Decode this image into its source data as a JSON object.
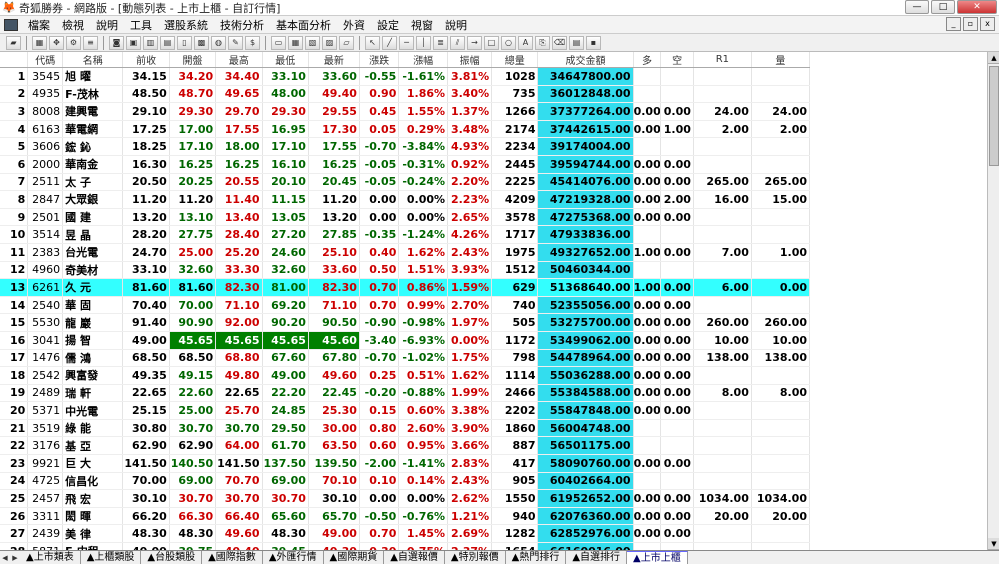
{
  "window": {
    "title": "奇狐勝券 - 網路版 - [動態列表 - 上市上櫃 - 自訂行情]",
    "app_icon": "fox-icon"
  },
  "menu": [
    "檔案",
    "檢視",
    "說明",
    "工具",
    "選股系統",
    "技術分析",
    "基本面分析",
    "外資",
    "設定",
    "視窗",
    "說明"
  ],
  "columns": [
    "代碼",
    "名稱",
    "前收",
    "開盤",
    "最高",
    "最低",
    "最新",
    "漲跌",
    "漲幅",
    "振幅",
    "總量",
    "成交金額",
    "多",
    "空",
    "R1",
    "量"
  ],
  "rows": [
    {
      "idx": "1",
      "code": "3545",
      "name": "旭 曜",
      "prev": "34.15",
      "open": "34.20",
      "high": "34.40",
      "low": "33.10",
      "last": "33.60",
      "chg": "-0.55",
      "pct": "-1.61%",
      "amp": "3.81%",
      "vol": "1028",
      "tv": "34647800.00",
      "long": "",
      "short": "",
      "r1": "",
      "q": "",
      "oc": "up",
      "hc": "up",
      "lc": "dn",
      "lac": "dn"
    },
    {
      "idx": "2",
      "code": "4935",
      "name": "F-茂林",
      "prev": "48.50",
      "open": "48.70",
      "high": "49.65",
      "low": "48.00",
      "last": "49.40",
      "chg": "0.90",
      "pct": "1.86%",
      "amp": "3.40%",
      "vol": "735",
      "tv": "36012848.00",
      "long": "",
      "short": "",
      "r1": "",
      "q": "",
      "oc": "up",
      "hc": "up",
      "lc": "dn",
      "lac": "up"
    },
    {
      "idx": "3",
      "code": "8008",
      "name": "建興電",
      "prev": "29.10",
      "open": "29.30",
      "high": "29.70",
      "low": "29.30",
      "last": "29.55",
      "chg": "0.45",
      "pct": "1.55%",
      "amp": "1.37%",
      "vol": "1266",
      "tv": "37377264.00",
      "long": "0.00",
      "short": "0.00",
      "r1": "24.00",
      "q": "24.00",
      "oc": "up",
      "hc": "up",
      "lc": "up",
      "lac": "up"
    },
    {
      "idx": "4",
      "code": "6163",
      "name": "華電網",
      "prev": "17.25",
      "open": "17.00",
      "high": "17.55",
      "low": "16.95",
      "last": "17.30",
      "chg": "0.05",
      "pct": "0.29%",
      "amp": "3.48%",
      "vol": "2174",
      "tv": "37442615.00",
      "long": "0.00",
      "short": "1.00",
      "r1": "2.00",
      "q": "2.00",
      "oc": "dn",
      "hc": "up",
      "lc": "dn",
      "lac": "up"
    },
    {
      "idx": "5",
      "code": "3606",
      "name": "鋐 鈊",
      "prev": "18.25",
      "open": "17.10",
      "high": "18.00",
      "low": "17.10",
      "last": "17.55",
      "chg": "-0.70",
      "pct": "-3.84%",
      "amp": "4.93%",
      "vol": "2234",
      "tv": "39174004.00",
      "long": "",
      "short": "",
      "r1": "",
      "q": "",
      "oc": "dn",
      "hc": "dn",
      "lc": "dn",
      "lac": "dn"
    },
    {
      "idx": "6",
      "code": "2000",
      "name": "華南金",
      "prev": "16.30",
      "open": "16.25",
      "high": "16.25",
      "low": "16.10",
      "last": "16.25",
      "chg": "-0.05",
      "pct": "-0.31%",
      "amp": "0.92%",
      "vol": "2445",
      "tv": "39594744.00",
      "long": "0.00",
      "short": "0.00",
      "r1": "",
      "q": "",
      "oc": "dn",
      "hc": "dn",
      "lc": "dn",
      "lac": "dn"
    },
    {
      "idx": "7",
      "code": "2511",
      "name": "太 子",
      "prev": "20.50",
      "open": "20.25",
      "high": "20.55",
      "low": "20.10",
      "last": "20.45",
      "chg": "-0.05",
      "pct": "-0.24%",
      "amp": "2.20%",
      "vol": "2225",
      "tv": "45414076.00",
      "long": "0.00",
      "short": "0.00",
      "r1": "265.00",
      "q": "265.00",
      "oc": "dn",
      "hc": "up",
      "lc": "dn",
      "lac": "dn"
    },
    {
      "idx": "8",
      "code": "2847",
      "name": "大眾銀",
      "prev": "11.20",
      "open": "11.20",
      "high": "11.40",
      "low": "11.15",
      "last": "11.20",
      "chg": "0.00",
      "pct": "0.00%",
      "amp": "2.23%",
      "vol": "4209",
      "tv": "47219328.00",
      "long": "0.00",
      "short": "2.00",
      "r1": "16.00",
      "q": "15.00",
      "oc": "flat",
      "hc": "up",
      "lc": "dn",
      "lac": "flat"
    },
    {
      "idx": "9",
      "code": "2501",
      "name": "國 建",
      "prev": "13.20",
      "open": "13.10",
      "high": "13.40",
      "low": "13.05",
      "last": "13.20",
      "chg": "0.00",
      "pct": "0.00%",
      "amp": "2.65%",
      "vol": "3578",
      "tv": "47275368.00",
      "long": "0.00",
      "short": "0.00",
      "r1": "",
      "q": "",
      "oc": "dn",
      "hc": "up",
      "lc": "dn",
      "lac": "flat"
    },
    {
      "idx": "10",
      "code": "3514",
      "name": "昱 晶",
      "prev": "28.20",
      "open": "27.75",
      "high": "28.40",
      "low": "27.20",
      "last": "27.85",
      "chg": "-0.35",
      "pct": "-1.24%",
      "amp": "4.26%",
      "vol": "1717",
      "tv": "47933836.00",
      "long": "",
      "short": "",
      "r1": "",
      "q": "",
      "oc": "dn",
      "hc": "up",
      "lc": "dn",
      "lac": "dn"
    },
    {
      "idx": "11",
      "code": "2383",
      "name": "台光電",
      "prev": "24.70",
      "open": "25.00",
      "high": "25.20",
      "low": "24.60",
      "last": "25.10",
      "chg": "0.40",
      "pct": "1.62%",
      "amp": "2.43%",
      "vol": "1975",
      "tv": "49327652.00",
      "long": "1.00",
      "short": "0.00",
      "r1": "7.00",
      "q": "1.00",
      "oc": "up",
      "hc": "up",
      "lc": "dn",
      "lac": "up"
    },
    {
      "idx": "12",
      "code": "4960",
      "name": "奇美材",
      "prev": "33.10",
      "open": "32.60",
      "high": "33.30",
      "low": "32.60",
      "last": "33.60",
      "chg": "0.50",
      "pct": "1.51%",
      "amp": "3.93%",
      "vol": "1512",
      "tv": "50460344.00",
      "long": "",
      "short": "",
      "r1": "",
      "q": "",
      "oc": "dn",
      "hc": "up",
      "lc": "dn",
      "lac": "up"
    },
    {
      "idx": "13",
      "code": "6261",
      "name": "久 元",
      "prev": "81.60",
      "open": "81.60",
      "high": "82.30",
      "low": "81.00",
      "last": "82.30",
      "chg": "0.70",
      "pct": "0.86%",
      "amp": "1.59%",
      "vol": "629",
      "tv": "51368640.00",
      "long": "1.00",
      "short": "0.00",
      "r1": "6.00",
      "q": "0.00",
      "oc": "flat",
      "hc": "up",
      "lc": "dn",
      "lac": "up",
      "sel": true
    },
    {
      "idx": "14",
      "code": "2540",
      "name": "華 固",
      "prev": "70.40",
      "open": "70.00",
      "high": "71.10",
      "low": "69.20",
      "last": "71.10",
      "chg": "0.70",
      "pct": "0.99%",
      "amp": "2.70%",
      "vol": "740",
      "tv": "52355056.00",
      "long": "0.00",
      "short": "0.00",
      "r1": "",
      "q": "",
      "oc": "dn",
      "hc": "up",
      "lc": "dn",
      "lac": "up"
    },
    {
      "idx": "15",
      "code": "5530",
      "name": "龍 巖",
      "prev": "91.40",
      "open": "90.90",
      "high": "92.00",
      "low": "90.20",
      "last": "90.50",
      "chg": "-0.90",
      "pct": "-0.98%",
      "amp": "1.97%",
      "vol": "505",
      "tv": "53275700.00",
      "long": "0.00",
      "short": "0.00",
      "r1": "260.00",
      "q": "260.00",
      "oc": "dn",
      "hc": "up",
      "lc": "dn",
      "lac": "dn"
    },
    {
      "idx": "16",
      "code": "3041",
      "name": "揚 智",
      "prev": "49.00",
      "open": "45.65",
      "high": "45.65",
      "low": "45.65",
      "last": "45.60",
      "chg": "-3.40",
      "pct": "-6.93%",
      "amp": "0.00%",
      "vol": "1172",
      "tv": "53499062.00",
      "long": "0.00",
      "short": "0.00",
      "r1": "10.00",
      "q": "10.00",
      "oc": "lim",
      "hc": "lim",
      "lc": "lim",
      "lac": "lim"
    },
    {
      "idx": "17",
      "code": "1476",
      "name": "儒 鴻",
      "prev": "68.50",
      "open": "68.50",
      "high": "68.80",
      "low": "67.60",
      "last": "67.80",
      "chg": "-0.70",
      "pct": "-1.02%",
      "amp": "1.75%",
      "vol": "798",
      "tv": "54478964.00",
      "long": "0.00",
      "short": "0.00",
      "r1": "138.00",
      "q": "138.00",
      "oc": "flat",
      "hc": "up",
      "lc": "dn",
      "lac": "dn"
    },
    {
      "idx": "18",
      "code": "2542",
      "name": "興富發",
      "prev": "49.35",
      "open": "49.15",
      "high": "49.80",
      "low": "49.00",
      "last": "49.60",
      "chg": "0.25",
      "pct": "0.51%",
      "amp": "1.62%",
      "vol": "1114",
      "tv": "55036288.00",
      "long": "0.00",
      "short": "0.00",
      "r1": "",
      "q": "",
      "oc": "dn",
      "hc": "up",
      "lc": "dn",
      "lac": "up"
    },
    {
      "idx": "19",
      "code": "2489",
      "name": "瑞 軒",
      "prev": "22.65",
      "open": "22.60",
      "high": "22.65",
      "low": "22.20",
      "last": "22.45",
      "chg": "-0.20",
      "pct": "-0.88%",
      "amp": "1.99%",
      "vol": "2466",
      "tv": "55384588.00",
      "long": "0.00",
      "short": "0.00",
      "r1": "8.00",
      "q": "8.00",
      "oc": "dn",
      "hc": "flat",
      "lc": "dn",
      "lac": "dn"
    },
    {
      "idx": "20",
      "code": "5371",
      "name": "中光電",
      "prev": "25.15",
      "open": "25.00",
      "high": "25.70",
      "low": "24.85",
      "last": "25.30",
      "chg": "0.15",
      "pct": "0.60%",
      "amp": "3.38%",
      "vol": "2202",
      "tv": "55847848.00",
      "long": "0.00",
      "short": "0.00",
      "r1": "",
      "q": "",
      "oc": "dn",
      "hc": "up",
      "lc": "dn",
      "lac": "up"
    },
    {
      "idx": "21",
      "code": "3519",
      "name": "綠 能",
      "prev": "30.80",
      "open": "30.70",
      "high": "30.70",
      "low": "29.50",
      "last": "30.00",
      "chg": "0.80",
      "pct": "2.60%",
      "amp": "3.90%",
      "vol": "1860",
      "tv": "56004748.00",
      "long": "",
      "short": "",
      "r1": "",
      "q": "",
      "oc": "dn",
      "hc": "dn",
      "lc": "dn",
      "lac": "up"
    },
    {
      "idx": "22",
      "code": "3176",
      "name": "基 亞",
      "prev": "62.90",
      "open": "62.90",
      "high": "64.00",
      "low": "61.70",
      "last": "63.50",
      "chg": "0.60",
      "pct": "0.95%",
      "amp": "3.66%",
      "vol": "887",
      "tv": "56501175.00",
      "long": "",
      "short": "",
      "r1": "",
      "q": "",
      "oc": "flat",
      "hc": "up",
      "lc": "dn",
      "lac": "up"
    },
    {
      "idx": "23",
      "code": "9921",
      "name": "巨 大",
      "prev": "141.50",
      "open": "140.50",
      "high": "141.50",
      "low": "137.50",
      "last": "139.50",
      "chg": "-2.00",
      "pct": "-1.41%",
      "amp": "2.83%",
      "vol": "417",
      "tv": "58090760.00",
      "long": "0.00",
      "short": "0.00",
      "r1": "",
      "q": "",
      "oc": "dn",
      "hc": "flat",
      "lc": "dn",
      "lac": "dn"
    },
    {
      "idx": "24",
      "code": "4725",
      "name": "信昌化",
      "prev": "70.00",
      "open": "69.00",
      "high": "70.70",
      "low": "69.00",
      "last": "70.10",
      "chg": "0.10",
      "pct": "0.14%",
      "amp": "2.43%",
      "vol": "905",
      "tv": "60402664.00",
      "long": "",
      "short": "",
      "r1": "",
      "q": "",
      "oc": "dn",
      "hc": "up",
      "lc": "dn",
      "lac": "up"
    },
    {
      "idx": "25",
      "code": "2457",
      "name": "飛 宏",
      "prev": "30.10",
      "open": "30.70",
      "high": "30.70",
      "low": "30.70",
      "last": "30.10",
      "chg": "0.00",
      "pct": "0.00%",
      "amp": "2.62%",
      "vol": "1550",
      "tv": "61952652.00",
      "long": "0.00",
      "short": "0.00",
      "r1": "1034.00",
      "q": "1034.00",
      "oc": "up",
      "hc": "up",
      "lc": "up",
      "lac": "flat"
    },
    {
      "idx": "26",
      "code": "3311",
      "name": "閎 暉",
      "prev": "66.20",
      "open": "66.30",
      "high": "66.40",
      "low": "65.60",
      "last": "65.70",
      "chg": "-0.50",
      "pct": "-0.76%",
      "amp": "1.21%",
      "vol": "940",
      "tv": "62076360.00",
      "long": "0.00",
      "short": "0.00",
      "r1": "20.00",
      "q": "20.00",
      "oc": "up",
      "hc": "up",
      "lc": "dn",
      "lac": "dn"
    },
    {
      "idx": "27",
      "code": "2439",
      "name": "美 律",
      "prev": "48.30",
      "open": "48.30",
      "high": "49.60",
      "low": "48.30",
      "last": "49.00",
      "chg": "0.70",
      "pct": "1.45%",
      "amp": "2.69%",
      "vol": "1282",
      "tv": "62852976.00",
      "long": "0.00",
      "short": "0.00",
      "r1": "",
      "q": "",
      "oc": "flat",
      "hc": "up",
      "lc": "flat",
      "lac": "up"
    },
    {
      "idx": "28",
      "code": "5871",
      "name": "F-中租",
      "prev": "40.00",
      "open": "39.75",
      "high": "40.40",
      "low": "39.45",
      "last": "40.30",
      "chg": "0.30",
      "pct": "0.75%",
      "amp": "2.37%",
      "vol": "1654",
      "tv": "66160016.00",
      "long": "",
      "short": "",
      "r1": "",
      "q": "",
      "oc": "dn",
      "hc": "up",
      "lc": "dn",
      "lac": "up"
    },
    {
      "idx": "29",
      "code": "3454",
      "name": "晶 睿",
      "prev": "102.00",
      "open": "101.00",
      "high": "102.50",
      "low": "99.00",
      "last": "100.50",
      "chg": "-1.50",
      "pct": "-1.47%",
      "amp": "3.43%",
      "vol": "658",
      "tv": "66242676.00",
      "long": "",
      "short": "",
      "r1": "",
      "q": "",
      "oc": "dn",
      "hc": "up",
      "lc": "dn",
      "lac": "dn"
    }
  ],
  "tabs": [
    "上市類表",
    "上櫃類股",
    "台股類股",
    "國際指數",
    "外匯行情",
    "國際期貨",
    "自選報價",
    "特別報價",
    "熱門排行",
    "自選排行",
    "上市上櫃"
  ],
  "active_tab": 10,
  "colors": {
    "up": "#cc0000",
    "down": "#006600",
    "highlight": "#33ffff",
    "amount_bg": "#33ddee",
    "limit_bg": "#008000"
  }
}
